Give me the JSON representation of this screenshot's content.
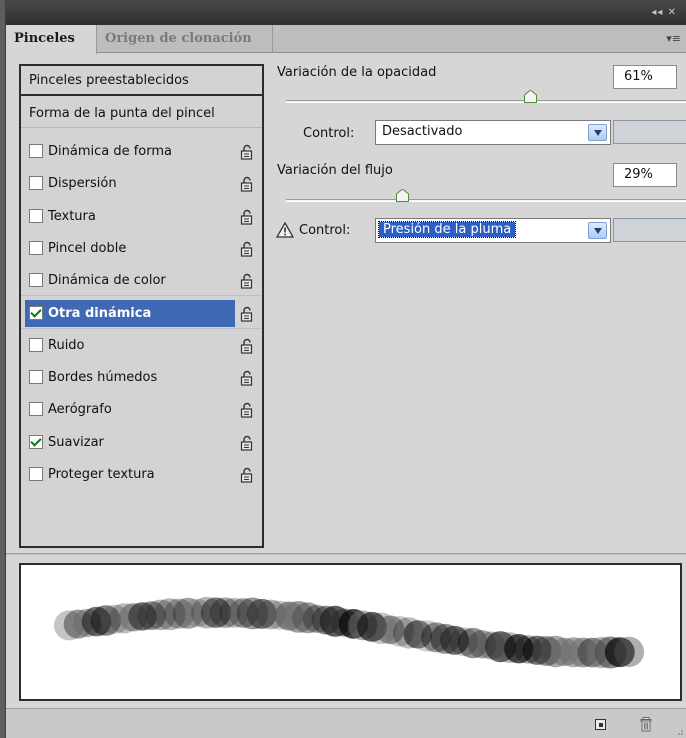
{
  "tabs": [
    {
      "label": "Pinceles"
    },
    {
      "label": "Origen de clonación"
    }
  ],
  "left_list": {
    "preset_label": "Pinceles preestablecidos",
    "tip_shape_label": "Forma de la punta del pincel",
    "items": [
      {
        "label": "Dinámica de forma",
        "checked": false,
        "selected": false
      },
      {
        "label": "Dispersión",
        "checked": false,
        "selected": false
      },
      {
        "label": "Textura",
        "checked": false,
        "selected": false
      },
      {
        "label": "Pincel doble",
        "checked": false,
        "selected": false
      },
      {
        "label": "Dinámica de color",
        "checked": false,
        "selected": false
      },
      {
        "label": "Otra dinámica",
        "checked": true,
        "selected": true
      },
      {
        "label": "Ruido",
        "checked": false,
        "selected": false
      },
      {
        "label": "Bordes húmedos",
        "checked": false,
        "selected": false
      },
      {
        "label": "Aerógrafo",
        "checked": false,
        "selected": false
      },
      {
        "label": "Suavizar",
        "checked": true,
        "selected": false
      },
      {
        "label": "Proteger textura",
        "checked": false,
        "selected": false
      }
    ]
  },
  "opacity": {
    "label": "Variación de la opacidad",
    "value": "61%",
    "slider_fraction": 0.61,
    "control_label": "Control:",
    "control_value": "Desactivado"
  },
  "flow": {
    "label": "Variación del flujo",
    "value": "29%",
    "slider_fraction": 0.29,
    "control_label": "Control:",
    "control_value": "Presión de la pluma"
  },
  "colors": {
    "selection": "#3f68b5",
    "panel_bg": "#d6d6d6",
    "warning": "#333333"
  }
}
